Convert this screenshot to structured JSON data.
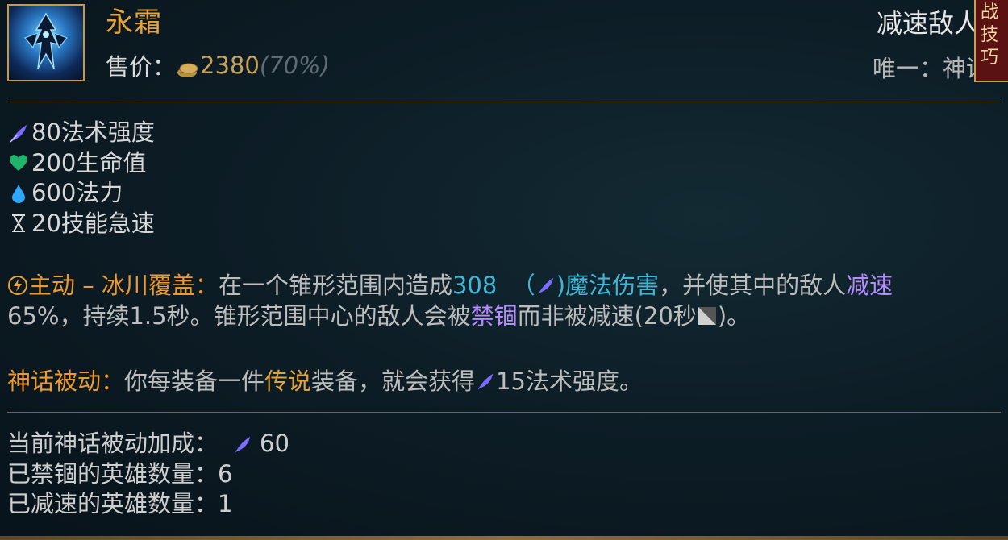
{
  "item": {
    "name": "永霜",
    "price_label": "售价：",
    "price_value": "2380",
    "price_pct": "(70%)",
    "icon": "everfrost-item-icon"
  },
  "cutoff": {
    "title": "减速敌人",
    "subtitle": "唯一：神话",
    "badge": "战技巧"
  },
  "stats": [
    {
      "icon": "ability-power-icon",
      "text": "80法术强度"
    },
    {
      "icon": "health-heart-icon",
      "text": "200生命值"
    },
    {
      "icon": "mana-drop-icon",
      "text": "600法力"
    },
    {
      "icon": "hourglass-icon",
      "text": "20技能急速"
    }
  ],
  "active": {
    "label": "主动 – 冰川覆盖：",
    "t1": "在一个锥形范围内造成",
    "damage": "308",
    "dmg_paren_open": "（",
    "dmg_paren_close": ")",
    "dmg_type": "魔法伤害",
    "t2": "，并使其中的敌人",
    "slow": "减速",
    "line2_a": "65%，持续1.5秒。锥形范围中心的敌人会被",
    "root": "禁锢",
    "line2_b": "而非被减速(20秒",
    "line2_c": ")。"
  },
  "passive": {
    "label": "神话被动：",
    "t1": "你每装备一件",
    "legend": "传说",
    "t2": "装备，就会获得",
    "t3": "15法术强度。"
  },
  "bottom": {
    "bonus_label": "当前神话被动加成：",
    "bonus_value": "60",
    "rooted_label": "已禁锢的英雄数量：",
    "rooted_value": "6",
    "slowed_label": "已减速的英雄数量：",
    "slowed_value": "1"
  },
  "colors": {
    "accent_gold": "#e8a33a",
    "ability_power": "#7a6cff",
    "health": "#1fb56a",
    "mana": "#2fa6ff",
    "cyan_value": "#3fb8d8",
    "purple_keyword": "#b58cff"
  }
}
